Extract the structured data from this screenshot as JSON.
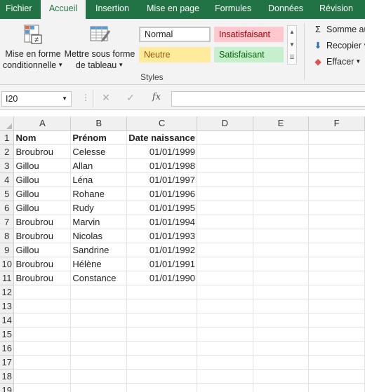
{
  "ribbon": {
    "tabs": [
      "Fichier",
      "Accueil",
      "Insertion",
      "Mise en page",
      "Formules",
      "Données",
      "Révision"
    ],
    "active_tab": "Accueil",
    "conditional_format": {
      "line1": "Mise en forme",
      "line2": "conditionnelle"
    },
    "format_table": {
      "line1": "Mettre sous forme",
      "line2": "de tableau"
    },
    "styles": {
      "normal": "Normal",
      "bad": "Insatisfaisant",
      "neutral": "Neutre",
      "good": "Satisfaisant",
      "group_label": "Styles"
    },
    "editing": {
      "sum": "Somme au",
      "fill": "Recopier",
      "clear": "Effacer"
    }
  },
  "formula_bar": {
    "name_box": "I20",
    "fx": "fx",
    "formula": ""
  },
  "sheet": {
    "columns": [
      "A",
      "B",
      "C",
      "D",
      "E",
      "F"
    ],
    "rows": [
      [
        "Nom",
        "Prénom",
        "Date naissance"
      ],
      [
        "Broubrou",
        "Celesse",
        "01/01/1999"
      ],
      [
        "Gillou",
        "Allan",
        "01/01/1998"
      ],
      [
        "Gillou",
        "Léna",
        "01/01/1997"
      ],
      [
        "Gillou",
        "Rohane",
        "01/01/1996"
      ],
      [
        "Gillou",
        "Rudy",
        "01/01/1995"
      ],
      [
        "Broubrou",
        "Marvin",
        "01/01/1994"
      ],
      [
        "Broubrou",
        "Nicolas",
        "01/01/1993"
      ],
      [
        "Gillou",
        "Sandrine",
        "01/01/1992"
      ],
      [
        "Broubrou",
        "Hélène",
        "01/01/1991"
      ],
      [
        "Broubrou",
        "Constance",
        "01/01/1990"
      ]
    ],
    "row_numbers": [
      "1",
      "2",
      "3",
      "4",
      "5",
      "6",
      "7",
      "8",
      "9",
      "10",
      "11",
      "12",
      "13",
      "14",
      "15",
      "16",
      "17",
      "18",
      "19"
    ]
  }
}
